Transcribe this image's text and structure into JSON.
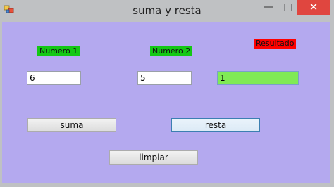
{
  "window": {
    "title": "suma y resta",
    "minimize_glyph": "—",
    "maximize_glyph": "□",
    "close_glyph": "✕"
  },
  "form": {
    "label_num1": "Numero 1",
    "label_num2": "Numero 2",
    "label_result": "Resultado",
    "num1_value": "6",
    "num2_value": "5",
    "result_value": "1",
    "btn_suma": "suma",
    "btn_resta": "resta",
    "btn_limpiar": "limpiar"
  },
  "colors": {
    "form_background": "#b4a9ef",
    "label_green": "#14c814",
    "label_red": "#ff0000",
    "result_field": "#80ea55",
    "close_button": "#e0463f"
  }
}
